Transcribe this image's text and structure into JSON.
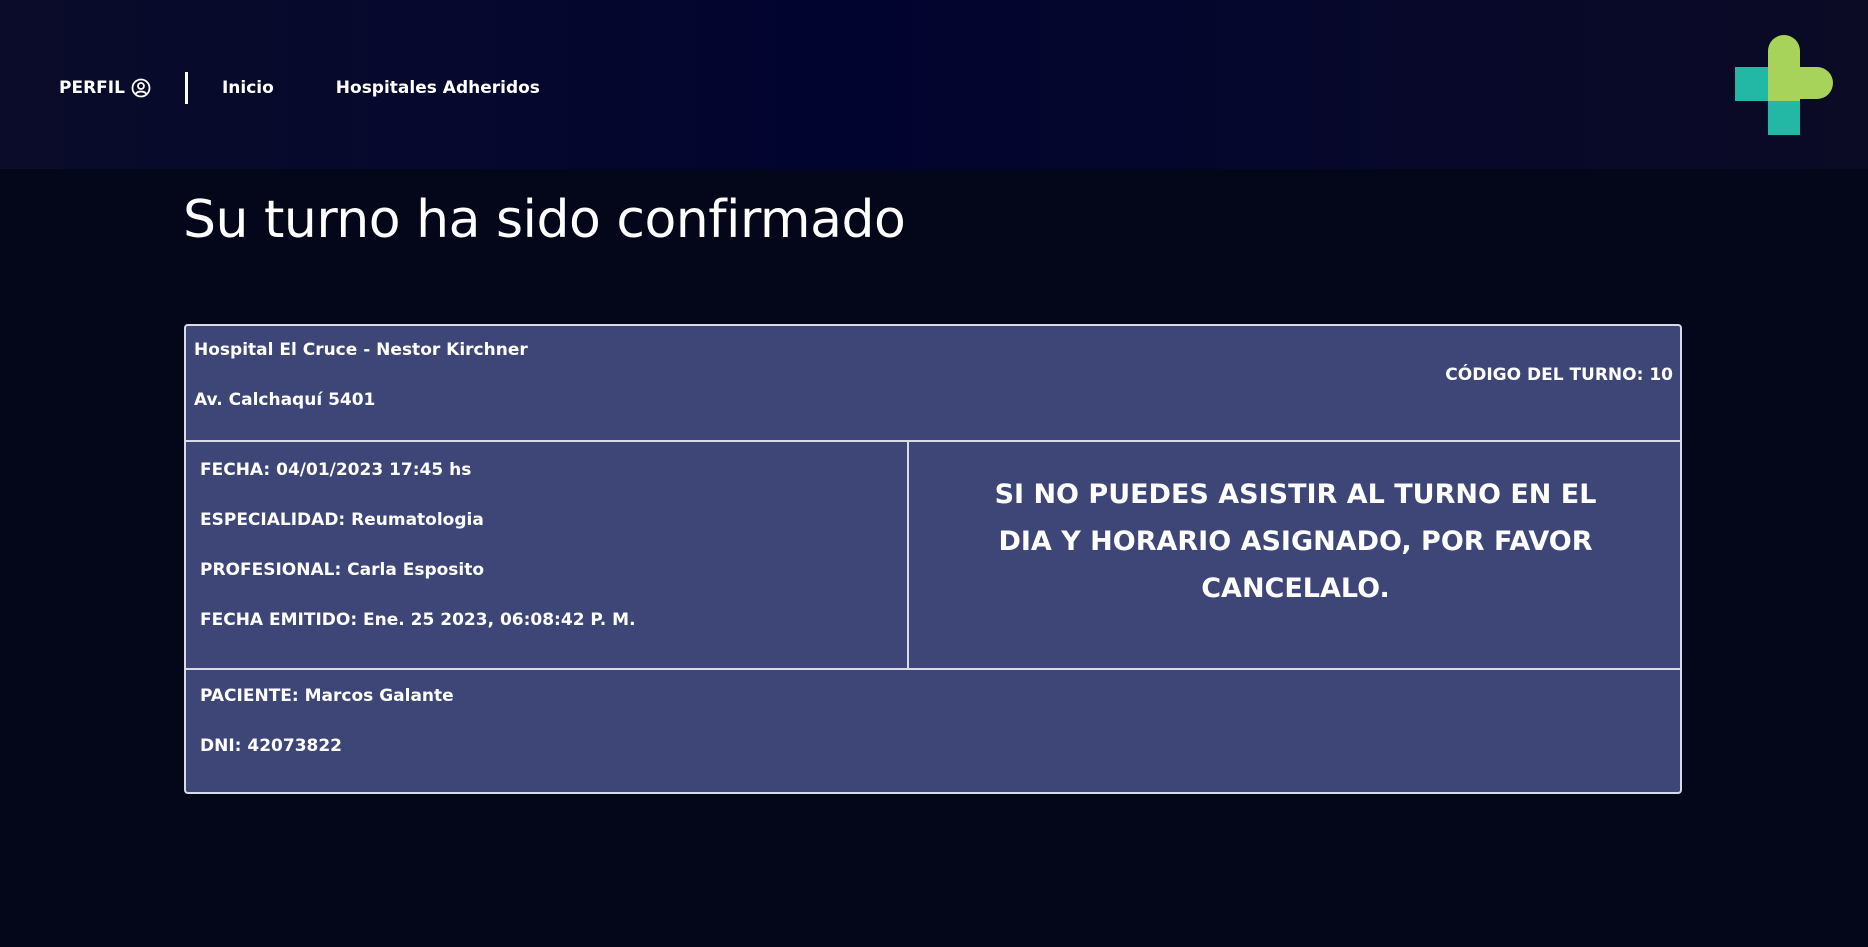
{
  "nav": {
    "profile_label": "PERFIL",
    "profile_icon": "user-circle-icon",
    "links": [
      "Inicio",
      "Hospitales Adheridos"
    ]
  },
  "logo": {
    "icon": "medical-cross-logo",
    "colors": {
      "teal": "#23b8a6",
      "green": "#a8d35a"
    }
  },
  "page": {
    "title": "Su turno ha sido confirmado"
  },
  "ticket": {
    "hospital_name": "Hospital El Cruce - Nestor Kirchner",
    "hospital_address": "Av. Calchaquí 5401",
    "turn_code": "CÓDIGO DEL TURNO: 10",
    "details": {
      "fecha": "FECHA: 04/01/2023 17:45 hs",
      "especialidad": "ESPECIALIDAD: Reumatologia",
      "profesional": "PROFESIONAL: Carla Esposito",
      "fecha_emitido": "FECHA EMITIDO: Ene. 25 2023, 06:08:42 P. M."
    },
    "warning": "SI NO PUEDES ASISTIR AL TURNO EN EL DIA Y HORARIO ASIGNADO, POR FAVOR CANCELALO.",
    "patient": {
      "paciente": "PACIENTE: Marcos Galante",
      "dni": "DNI: 42073822"
    }
  },
  "colors": {
    "background": "#04061a",
    "card": "#3e4678",
    "border": "#d8dae6"
  }
}
